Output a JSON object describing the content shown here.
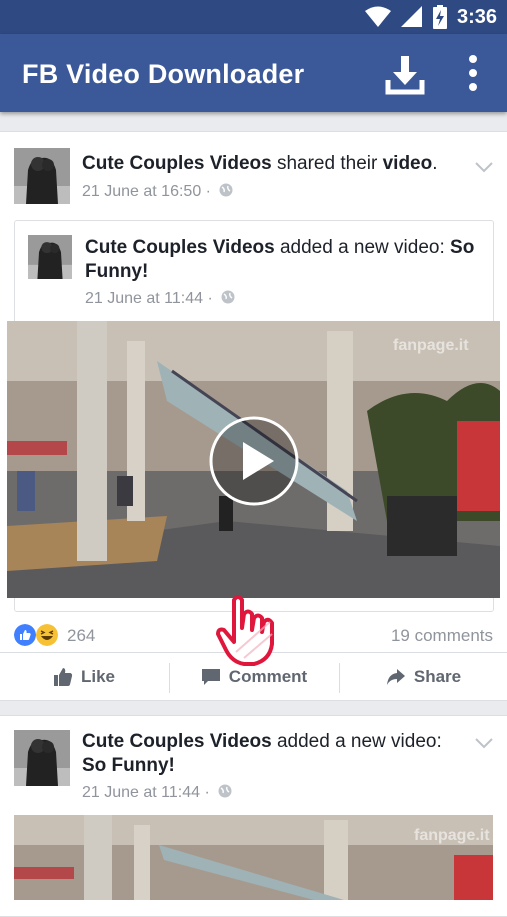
{
  "status": {
    "time": "3:36"
  },
  "appbar": {
    "title": "FB Video Downloader"
  },
  "post1": {
    "author": "Cute Couples Videos",
    "action": "shared their",
    "object": "video",
    "suffix": ".",
    "time": "21 June at 16:50 ·",
    "shared": {
      "author": "Cute Couples Videos",
      "action": "added a new video:",
      "video_title": "So Funny!",
      "time": "21 June at 11:44 ·",
      "watermark": "fanpage.it"
    },
    "reactions_count": "264",
    "comments": "19 comments",
    "actions": {
      "like": "Like",
      "comment": "Comment",
      "share": "Share"
    }
  },
  "post2": {
    "author": "Cute Couples Videos",
    "action": "added a new video:",
    "video_title": "So Funny!",
    "time": "21 June at 11:44 ·",
    "watermark": "fanpage.it"
  },
  "colors": {
    "brand": "#3b5998",
    "status": "#2f4a82",
    "hand": "#e0173d"
  }
}
